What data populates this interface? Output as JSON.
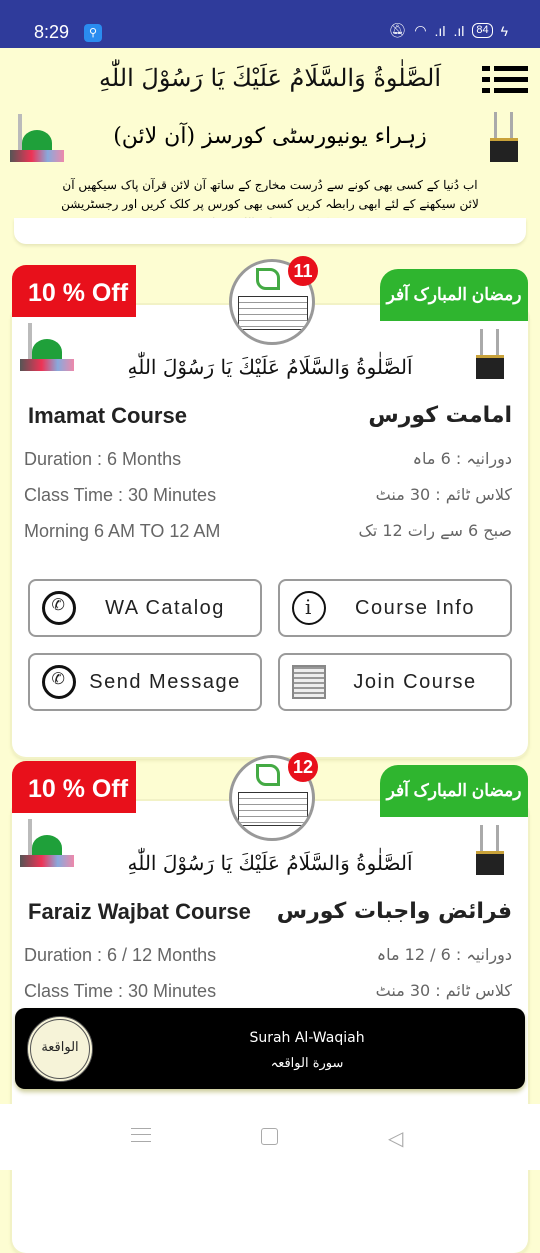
{
  "status_bar": {
    "time": "8:29",
    "battery": "84"
  },
  "header": {
    "salawat": "اَلصَّلٰوةُ وَالسَّلَامُ عَلَيْكَ يَا رَسُوْلَ اللّٰهِ",
    "title": "زہراء یونیورسٹی کورسز (آن لائن)",
    "description": "اب دُنیا کے کسی بھی کونے سے دُرست مخارج کے ساتھ آن لائن قرآن پاک سیکھیں آن لائن سیکھنے کے لئے ابھی رابطہ کریں کسی بھی کورس پر کلک کریں اور رجسٹریشن کروائیں جزاک اللہ خیرا"
  },
  "courses": [
    {
      "discount": "10 % Off",
      "offer": "رمضان المبارک آفر",
      "count": "11",
      "salawat": "اَلصَّلٰوةُ وَالسَّلَامُ عَلَيْكَ يَا رَسُوْلَ اللّٰهِ",
      "title": "Imamat Course",
      "title_ur": "امامت کورس",
      "lines": [
        "Duration : 6 Months",
        "Class Time : 30 Minutes",
        "Morning 6 AM TO 12 AM"
      ],
      "lines_ur": [
        "دورانیہ : 6 ماہ",
        "کلاس ٹائم : 30 منٹ",
        "صبح 6 سے رات 12 تک"
      ],
      "buttons": {
        "wa_catalog": "WA Catalog",
        "course_info": "Course Info",
        "send_message": "Send Message",
        "join_course": "Join Course"
      }
    },
    {
      "discount": "10 % Off",
      "offer": "رمضان المبارک آفر",
      "count": "12",
      "salawat": "اَلصَّلٰوةُ وَالسَّلَامُ عَلَيْكَ يَا رَسُوْلَ اللّٰهِ",
      "title": "Faraiz Wajbat Course",
      "title_ur": "فرائض واجبات کورس",
      "lines": [
        "Duration : 6 / 12 Months",
        "Class Time : 30 Minutes"
      ],
      "lines_ur": [
        "دورانیہ : 6 / 12 ماہ",
        "کلاس ٹائم : 30 منٹ"
      ]
    }
  ],
  "player": {
    "title": "Surah Al-Waqiah",
    "subtitle": "سورة الواقعہ",
    "art_label": "الواقعة"
  },
  "colors": {
    "status_bar": "#2f3b9b",
    "background": "#fdfdd2",
    "discount": "#e8101b",
    "offer": "#2fb52f"
  }
}
